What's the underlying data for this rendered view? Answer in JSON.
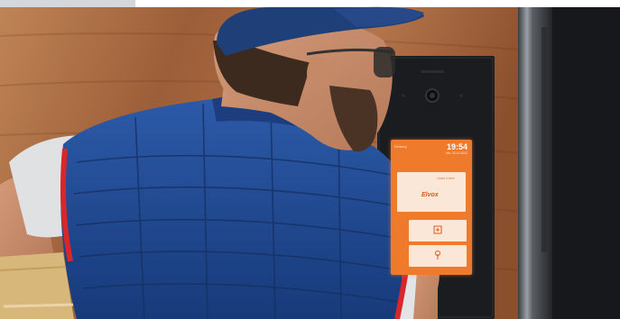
{
  "scene": {
    "subject": "delivery-person",
    "device": "video-intercom-panel"
  },
  "intercom_screen": {
    "status_text": "Delivery",
    "time": "19:54",
    "date": "Mo, 03.10.2022",
    "tile_note": "Leave it here",
    "brand_text": "Elvox"
  },
  "colors": {
    "wood": "#a0613a",
    "vest": "#20458c",
    "vest_trim": "#d8262a",
    "cap": "#1f3f78",
    "screen": "#ef7a2c",
    "panel": "#1a1c1f"
  },
  "icons": {
    "tile_mid": "parcel-scan-icon",
    "tile_bottom": "hand-tap-icon"
  }
}
